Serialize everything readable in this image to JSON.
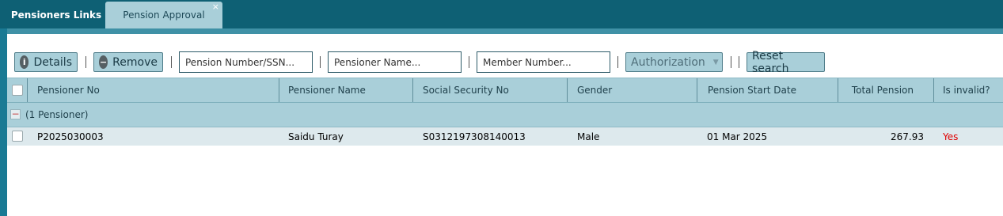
{
  "tabs": [
    {
      "label": "Pensioners Links",
      "active": false
    },
    {
      "label": "Pension Approval",
      "active": true,
      "close": "×"
    }
  ],
  "toolbar": {
    "details_label": "Details",
    "remove_label": "Remove",
    "authorization_label": "Authorization",
    "reset_label": "Reset search",
    "pension_number_placeholder": "Pension Number/SSN...",
    "pensioner_name_placeholder": "Pensioner Name...",
    "member_number_placeholder": "Member Number..."
  },
  "table": {
    "columns": [
      "Pensioner No",
      "Pensioner Name",
      "Social Security No",
      "Gender",
      "Pension Start Date",
      "Total Pension",
      "Is invalid?"
    ],
    "group_label": "(1 Pensioner)",
    "rows": [
      {
        "pensioner_no": "P2025030003",
        "pensioner_name": "Saidu Turay",
        "ssn": "S0312197308140013",
        "gender": "Male",
        "start_date": "01 Mar 2025",
        "total_pension": "267.93",
        "is_invalid": "Yes"
      }
    ]
  },
  "colors": {
    "tab_bar": "#0e6074",
    "active_tab": "#a9cfd9",
    "header_bg": "#a9cfd9",
    "row_bg": "#dde9ed",
    "invalid_text": "#e00000"
  },
  "icons": {
    "details": "info-icon",
    "remove": "minus-circle-icon",
    "authorization": "caret-down-icon",
    "tab_close": "close-icon",
    "group": "collapse-icon"
  }
}
